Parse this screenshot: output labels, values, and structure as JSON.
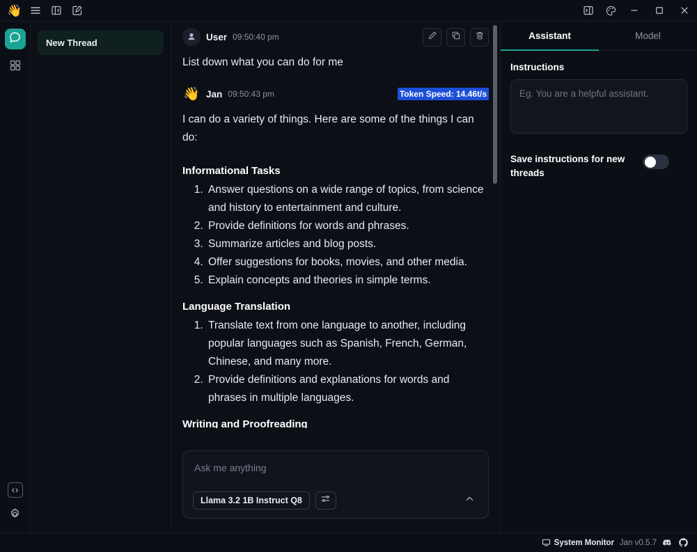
{
  "titlebar": {
    "wave_icon": "waving-hand-emoji",
    "menu_icon": "hamburger-menu-icon",
    "panel_left_icon": "collapse-left-panel-icon",
    "compose_icon": "new-thread-compose-icon",
    "panel_right_icon": "toggle-right-panel-icon",
    "theme_icon": "palette-theme-icon",
    "minimize_icon": "minimize-icon",
    "maximize_icon": "maximize-icon",
    "close_icon": "close-icon"
  },
  "rail": {
    "chat_icon": "chat-bubble-icon",
    "apps_icon": "grid-apps-icon",
    "code_icon": "code-brackets-icon",
    "settings_icon": "gear-settings-icon"
  },
  "sidebar": {
    "threads": [
      {
        "title": "New Thread"
      }
    ]
  },
  "chat": {
    "messages": [
      {
        "sender": "User",
        "time": "09:50:40 pm",
        "avatar": "user-avatar-icon",
        "text": "List down what you can do for me",
        "actions": [
          {
            "name": "edit-message-button",
            "icon": "pencil-icon"
          },
          {
            "name": "copy-message-button",
            "icon": "copy-icon"
          },
          {
            "name": "delete-message-button",
            "icon": "trash-icon"
          }
        ]
      },
      {
        "sender": "Jan",
        "time": "09:50:43 pm",
        "avatar": "waving-hand-emoji",
        "token_speed": "Token Speed: 14.46t/s",
        "intro": "I can do a variety of things. Here are some of the things I can do:",
        "sections": [
          {
            "heading": "Informational Tasks",
            "items": [
              "Answer questions on a wide range of topics, from science and history to entertainment and culture.",
              "Provide definitions for words and phrases.",
              "Summarize articles and blog posts.",
              "Offer suggestions for books, movies, and other media.",
              "Explain concepts and theories in simple terms."
            ]
          },
          {
            "heading": "Language Translation",
            "items": [
              "Translate text from one language to another, including popular languages such as Spanish, French, German, Chinese, and many more.",
              "Provide definitions and explanations for words and phrases in multiple languages."
            ]
          },
          {
            "heading": "Writing and Proofreading",
            "items": []
          }
        ]
      }
    ]
  },
  "composer": {
    "placeholder": "Ask me anything",
    "model": "Llama 3.2 1B Instruct Q8",
    "settings_icon": "sliders-settings-icon",
    "collapse_icon": "chevron-up-icon"
  },
  "rightpanel": {
    "tabs": [
      {
        "label": "Assistant",
        "active": true
      },
      {
        "label": "Model",
        "active": false
      }
    ],
    "instructions_label": "Instructions",
    "instructions_placeholder": "Eg. You are a helpful assistant.",
    "instructions_value": "",
    "save_toggle_label": "Save instructions for new threads",
    "save_toggle_on": false
  },
  "statusbar": {
    "monitor_icon": "system-monitor-icon",
    "monitor_label": "System Monitor",
    "version": "Jan v0.5.7",
    "discord_icon": "discord-icon",
    "github_icon": "github-icon"
  },
  "colors": {
    "accent": "#1aa394",
    "selection": "#1c4fd8",
    "background": "#0c0f16"
  }
}
